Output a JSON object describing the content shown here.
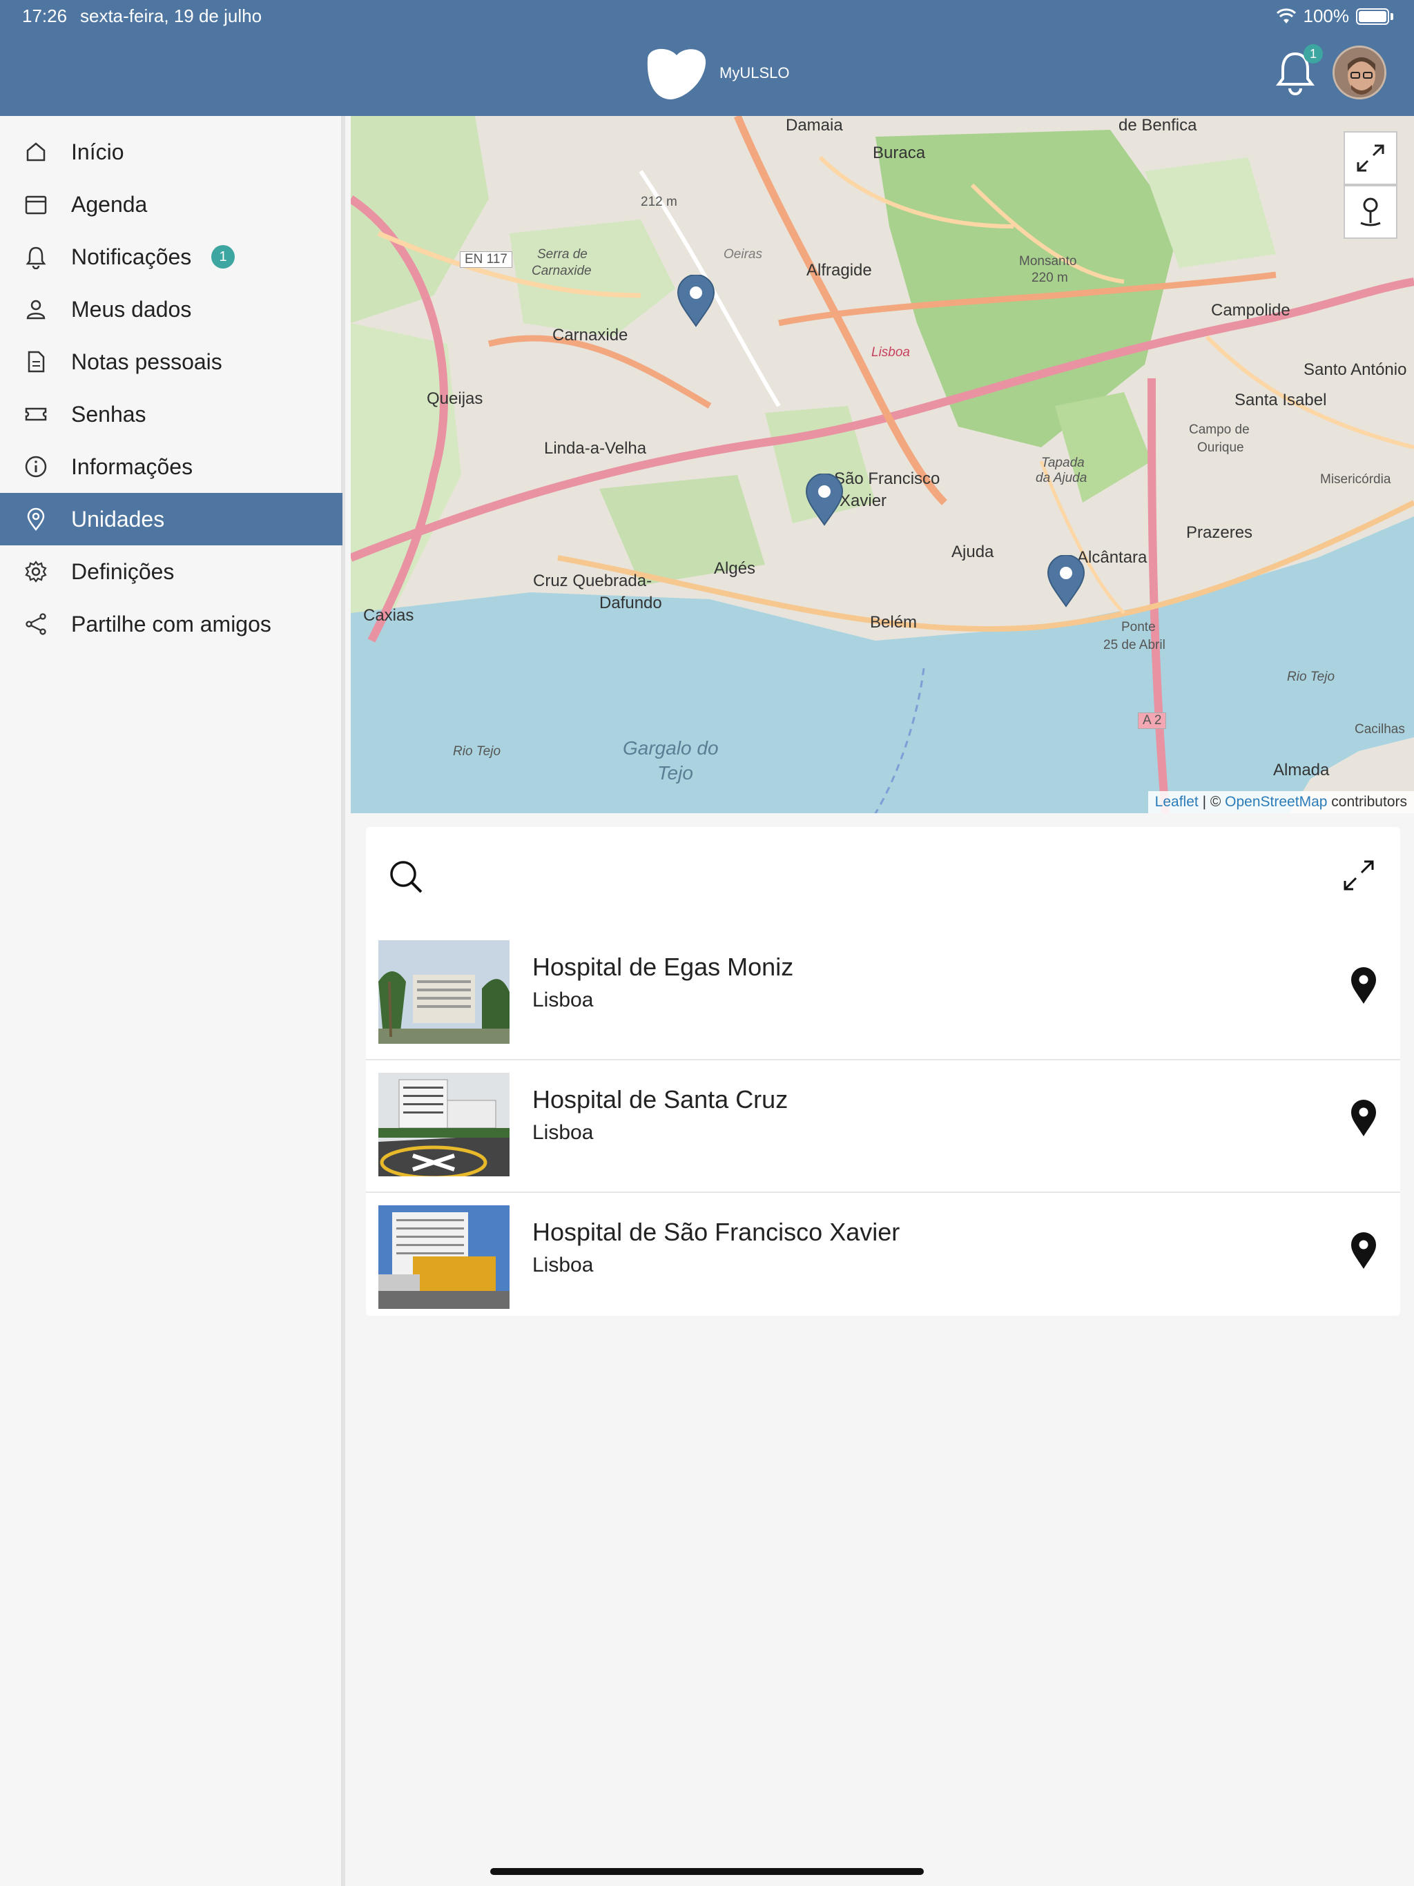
{
  "status_bar": {
    "time": "17:26",
    "date": "sexta-feira, 19 de julho",
    "battery": "100%"
  },
  "header": {
    "app_name": "MyULSLO",
    "notifications_count": "1"
  },
  "sidebar": {
    "items": [
      {
        "label": "Início",
        "icon": "home-icon"
      },
      {
        "label": "Agenda",
        "icon": "calendar-icon"
      },
      {
        "label": "Notificações",
        "icon": "bell-icon",
        "badge": "1"
      },
      {
        "label": "Meus dados",
        "icon": "user-icon"
      },
      {
        "label": "Notas pessoais",
        "icon": "document-icon"
      },
      {
        "label": "Senhas",
        "icon": "ticket-icon"
      },
      {
        "label": "Informações",
        "icon": "info-icon"
      },
      {
        "label": "Unidades",
        "icon": "location-icon",
        "active": true
      },
      {
        "label": "Definições",
        "icon": "gear-icon"
      },
      {
        "label": "Partilhe com amigos",
        "icon": "share-icon"
      }
    ]
  },
  "map": {
    "attribution_leaflet": "Leaflet",
    "attribution_sep": "| ©",
    "attribution_osm": "OpenStreetMap",
    "attribution_suffix": "contributors",
    "labels": {
      "damaia": "Damaia",
      "buraca": "Buraca",
      "benfica": "de Benfica",
      "alfragide": "Alfragide",
      "carnaxide": "Carnaxide",
      "queijas": "Queijas",
      "linda": "Linda-a-Velha",
      "monsanto": "Monsanto",
      "monsanto_alt": "220 m",
      "campolide": "Campolide",
      "santo_antonio": "Santo António",
      "santa_isabel": "Santa Isabel",
      "campo_ourique_1": "Campo de",
      "campo_ourique_2": "Ourique",
      "prazeres": "Prazeres",
      "misericordia": "Misericórdia",
      "alcantara": "Alcântara",
      "ajuda": "Ajuda",
      "belem": "Belém",
      "alges": "Algés",
      "cruz_1": "Cruz Quebrada-",
      "cruz_2": "Dafundo",
      "caxias": "Caxias",
      "sfx_1": "São Francisco",
      "sfx_2": "Xavier",
      "ponte_1": "Ponte",
      "ponte_2": "25 de Abril",
      "gargalo_1": "Gargalo do",
      "gargalo_2": "Tejo",
      "rio_tejo_1": "Rio Tejo",
      "rio_tejo_2": "Rio Tejo",
      "almada": "Almada",
      "cacilhas": "Cacilhas",
      "en117": "EN 117",
      "a2": "A 2",
      "alt212": "212 m",
      "serra_1": "Serra de",
      "serra_2": "Carnaxide",
      "tapada_1": "Tapada",
      "tapada_2": "da Ajuda",
      "oeiras": "Oeiras",
      "lisboa": "Lisboa"
    }
  },
  "units": {
    "items": [
      {
        "name": "Hospital de Egas Moniz",
        "city": "Lisboa"
      },
      {
        "name": "Hospital de Santa Cruz",
        "city": "Lisboa"
      },
      {
        "name": "Hospital de São Francisco Xavier",
        "city": "Lisboa"
      }
    ]
  },
  "colors": {
    "brand": "#4e76a0",
    "badge": "#3da6a0",
    "marker": "#4e76a0"
  }
}
